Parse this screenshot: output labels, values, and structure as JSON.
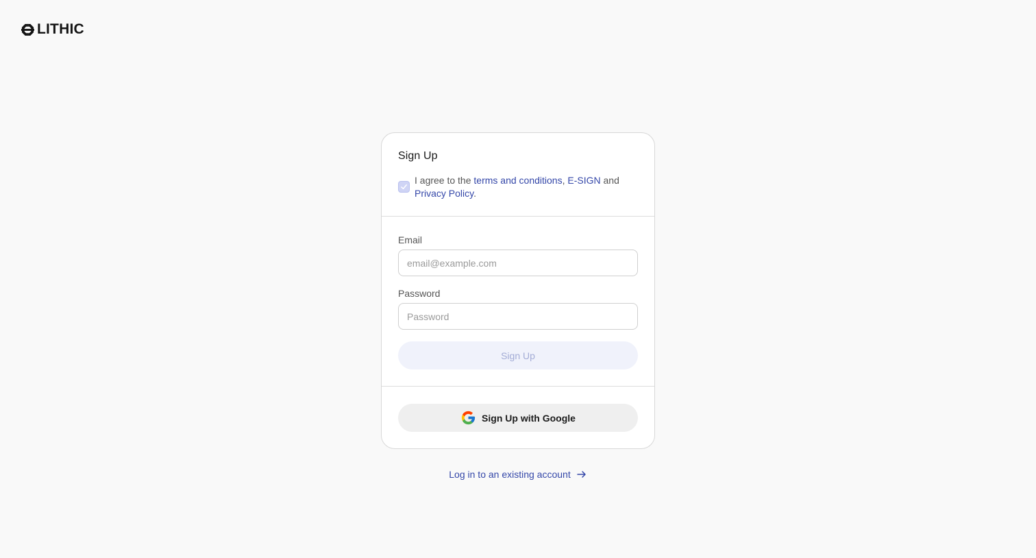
{
  "brand": {
    "name": "LITHIC",
    "logo_icon": "lithic-mark-icon"
  },
  "signup": {
    "title": "Sign Up",
    "agree": {
      "checked": true,
      "prefix": "I agree to the ",
      "terms_link": "terms and conditions",
      "sep": ", ",
      "esign_link": "E-SIGN",
      "and": " and",
      "privacy_link": "Privacy Policy",
      "suffix": "."
    },
    "email": {
      "label": "Email",
      "placeholder": "email@example.com",
      "value": ""
    },
    "password": {
      "label": "Password",
      "placeholder": "Password",
      "value": ""
    },
    "submit_label": "Sign Up",
    "google_label": "Sign Up with Google"
  },
  "login": {
    "link_label": "Log in to an existing account",
    "icon": "arrow-right-icon"
  },
  "colors": {
    "background": "#f9f9f9",
    "link": "#3346a8",
    "disabled_button_bg": "#f0f2fb",
    "disabled_button_text": "#a3acd6"
  }
}
